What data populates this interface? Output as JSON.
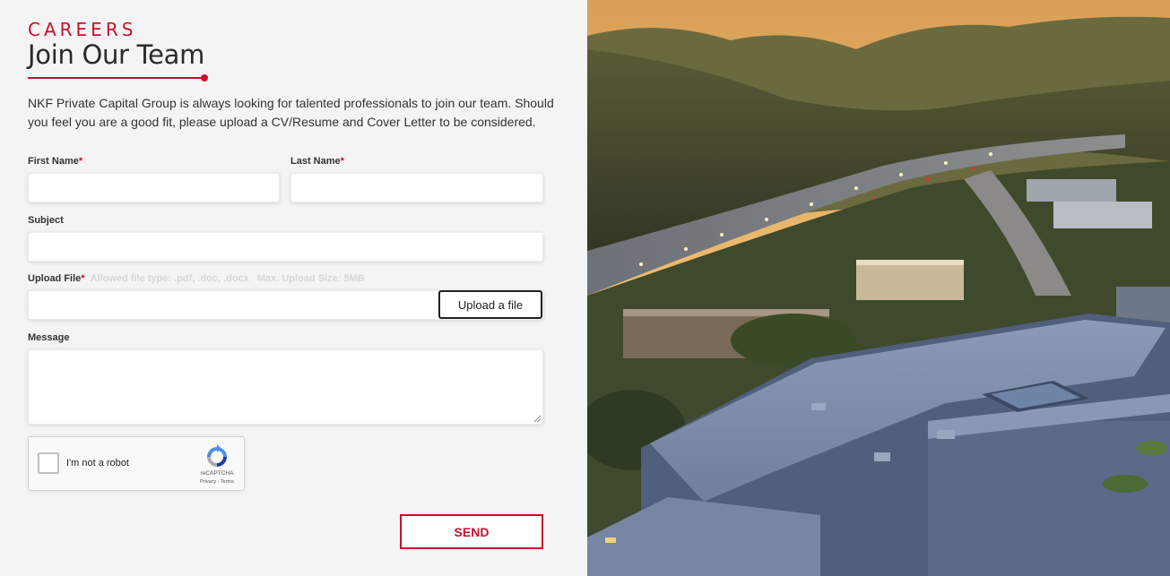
{
  "header": {
    "eyebrow": "CAREERS",
    "title": "Join Our Team",
    "intro": "NKF Private Capital Group is always looking for talented professionals to join our team. Should you feel you are a good fit, please upload a CV/Resume and Cover Letter to be considered."
  },
  "form": {
    "first_name": {
      "label": "First Name",
      "required_mark": "*",
      "value": ""
    },
    "last_name": {
      "label": "Last Name",
      "required_mark": "*",
      "value": ""
    },
    "subject": {
      "label": "Subject",
      "value": ""
    },
    "upload": {
      "label": "Upload File",
      "required_mark": "*",
      "allowed_hint": "Allowed file type: .pdf, .doc, .docx",
      "size_hint": "Max. Upload Size: 5MB",
      "button_label": "Upload a file",
      "value": ""
    },
    "message": {
      "label": "Message",
      "value": ""
    },
    "recaptcha": {
      "label": "I'm not a robot",
      "brand": "reCAPTCHA",
      "links": "Privacy - Terms",
      "icon": "recaptcha-logo-icon"
    },
    "send_label": "SEND"
  },
  "image": {
    "description_icon": "hero-photo",
    "alt": ""
  },
  "colors": {
    "accent": "#c8102e",
    "text": "#333333",
    "background": "#f4f4f4"
  }
}
